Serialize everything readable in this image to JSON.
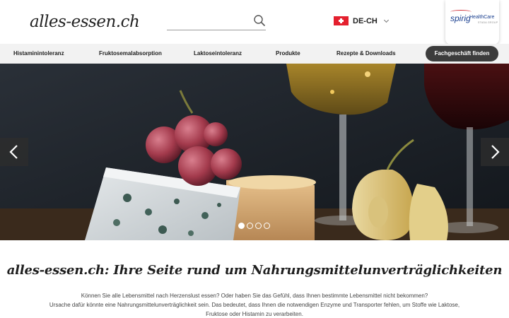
{
  "header": {
    "logo": "alles-essen.ch",
    "search_placeholder": "",
    "language": {
      "code": "DE-CH",
      "flag": "swiss-flag-icon"
    },
    "partner": {
      "name": "spirig",
      "sub": "HealthCare",
      "group": "STADA GROUP",
      "color": "#1a3f8f"
    }
  },
  "nav": {
    "items": [
      "Histaminintoleranz",
      "Fruktosemalabsorption",
      "Laktoseintoleranz",
      "Produkte",
      "Rezepte & Downloads"
    ],
    "cta": "Fachgeschäft finden"
  },
  "slider": {
    "slide_count": 4,
    "active_index": 0,
    "image": "cheese-grapes-wine-pear"
  },
  "intro": {
    "title": "alles-essen.ch: Ihre Seite rund um Nahrungsmittelunverträglichkeiten",
    "line1": "Können Sie alle Lebensmittel nach Herzenslust essen? Oder haben Sie das Gefühl, dass Ihnen bestimmte Lebensmittel nicht bekommen?",
    "line2": "Ursache dafür könnte eine Nahrungsmittelunverträglichkeit sein. Das bedeutet, dass Ihnen die notwendigen Enzyme und Transporter fehlen, um Stoffe wie Laktose,",
    "line3": "Fruktose oder Histamin zu verarbeiten."
  },
  "colors": {
    "nav_bg": "#f2f2f2",
    "cta_bg": "#3c3c3c",
    "flag_red": "#e4202e"
  }
}
